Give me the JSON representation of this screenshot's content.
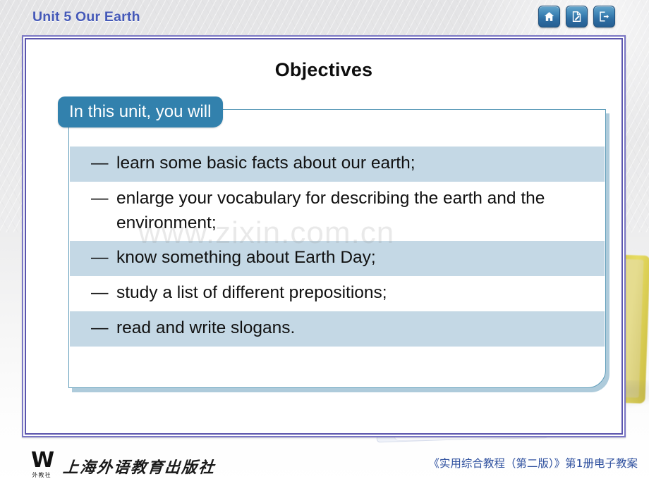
{
  "header": {
    "unit_title": "Unit 5 Our Earth",
    "nav_buttons": [
      {
        "name": "home-button",
        "icon": "home-icon",
        "label": "Home"
      },
      {
        "name": "notes-button",
        "icon": "edit-document-icon",
        "label": "Notes"
      },
      {
        "name": "exit-button",
        "icon": "exit-icon",
        "label": "Exit"
      }
    ]
  },
  "slide": {
    "title": "Objectives",
    "tab_label": "In this unit, you will",
    "dash": "—",
    "objectives": [
      "learn some basic facts about our earth;",
      "enlarge your vocabulary for describing the earth and the environment;",
      "know something about Earth Day;",
      "study a list of different prepositions;",
      "read and write slogans."
    ],
    "watermark": "www.zixin.com.cn"
  },
  "footer": {
    "publisher_mark": "W",
    "publisher_mark_sub": "外教社",
    "publisher_name": "上海外语教育出版社",
    "course_label": "《实用综合教程（第二版）》第1册电子教案"
  },
  "colors": {
    "title_blue": "#4559b8",
    "tab_blue": "#3281ad",
    "row_alt": "#c4d8e5",
    "frame_purple": "#5b55ad",
    "panel_border": "#5e9cb9",
    "footer_blue": "#2d4f9e"
  }
}
